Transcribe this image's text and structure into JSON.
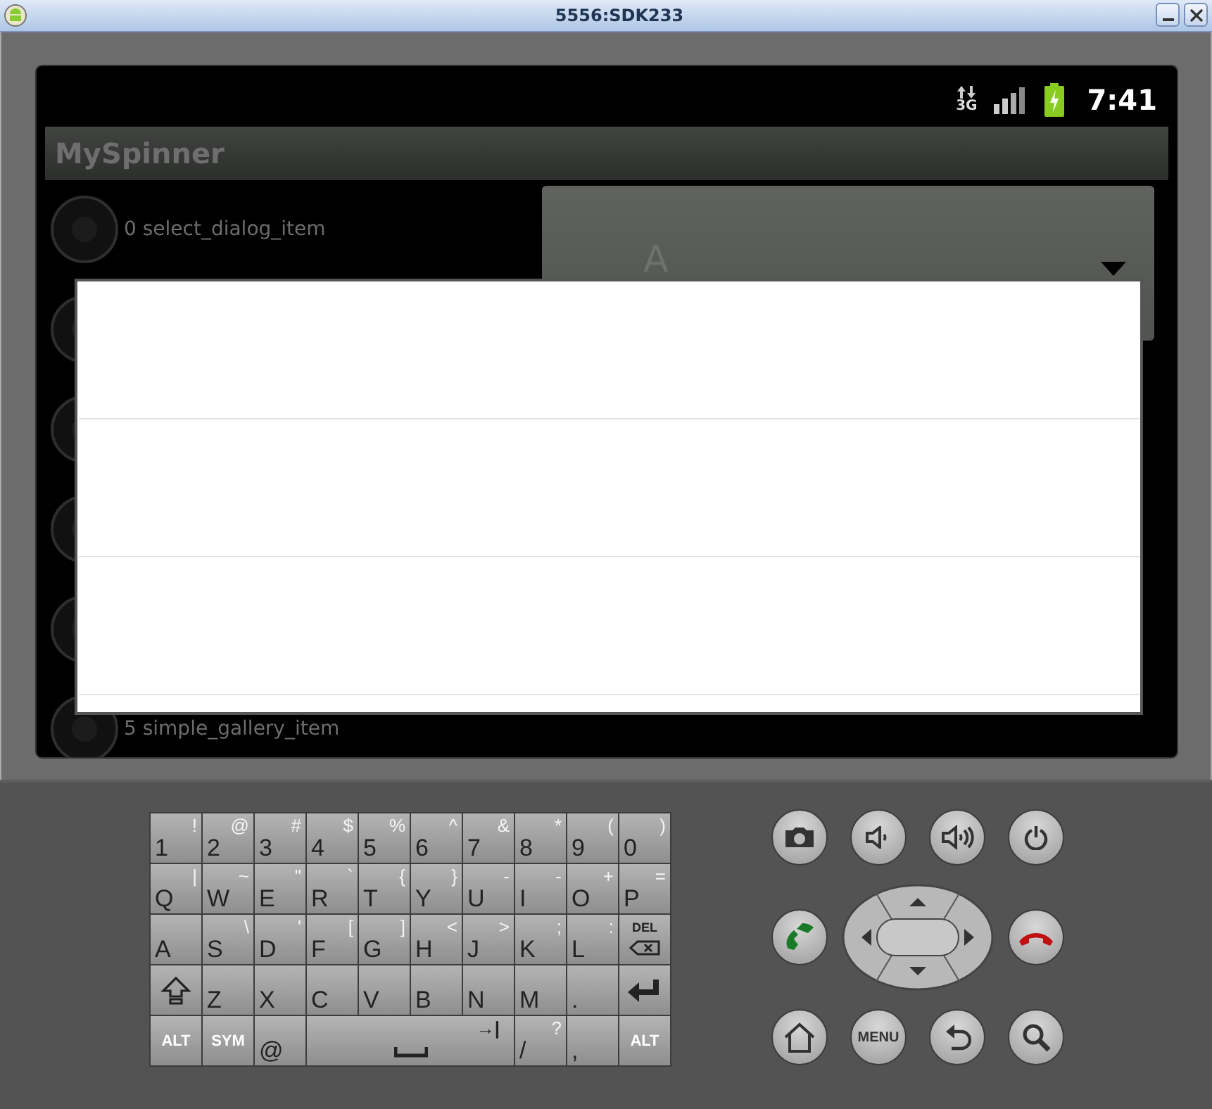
{
  "window": {
    "title": "5556:SDK233"
  },
  "status_bar": {
    "network": "3G",
    "time": "7:41"
  },
  "app_bar": {
    "title": "MySpinner"
  },
  "radio_items": [
    {
      "label": "0 select_dialog_item",
      "selected": false
    },
    {
      "selected": false
    },
    {
      "selected": false
    },
    {
      "selected": false
    },
    {
      "selected": false
    },
    {
      "label": "5 simple_gallery_item",
      "selected": false
    }
  ],
  "spinner": {
    "value": "A"
  },
  "keyboard": {
    "keys": [
      {
        "kind": "char",
        "main": "1",
        "alt": "!"
      },
      {
        "kind": "char",
        "main": "2",
        "alt": "@"
      },
      {
        "kind": "char",
        "main": "3",
        "alt": "#"
      },
      {
        "kind": "char",
        "main": "4",
        "alt": "$"
      },
      {
        "kind": "char",
        "main": "5",
        "alt": "%"
      },
      {
        "kind": "char",
        "main": "6",
        "alt": "^"
      },
      {
        "kind": "char",
        "main": "7",
        "alt": "&"
      },
      {
        "kind": "char",
        "main": "8",
        "alt": "*"
      },
      {
        "kind": "char",
        "main": "9",
        "alt": "("
      },
      {
        "kind": "char",
        "main": "0",
        "alt": ")"
      },
      {
        "kind": "char",
        "main": "Q",
        "alt": "|"
      },
      {
        "kind": "char",
        "main": "W",
        "alt": "~"
      },
      {
        "kind": "char",
        "main": "E",
        "alt": "\""
      },
      {
        "kind": "char",
        "main": "R",
        "alt": "`"
      },
      {
        "kind": "char",
        "main": "T",
        "alt": "{"
      },
      {
        "kind": "char",
        "main": "Y",
        "alt": "}"
      },
      {
        "kind": "char",
        "main": "U",
        "alt": "-"
      },
      {
        "kind": "char",
        "main": "I",
        "alt": "-"
      },
      {
        "kind": "char",
        "main": "O",
        "alt": "+"
      },
      {
        "kind": "char",
        "main": "P",
        "alt": "="
      },
      {
        "kind": "char",
        "main": "A"
      },
      {
        "kind": "char",
        "main": "S",
        "alt": "\\"
      },
      {
        "kind": "char",
        "main": "D",
        "alt": "'"
      },
      {
        "kind": "char",
        "main": "F",
        "alt": "["
      },
      {
        "kind": "char",
        "main": "G",
        "alt": "]"
      },
      {
        "kind": "char",
        "main": "H",
        "alt": "<"
      },
      {
        "kind": "char",
        "main": "J",
        "alt": ">"
      },
      {
        "kind": "char",
        "main": "K",
        "alt": ";"
      },
      {
        "kind": "char",
        "main": "L",
        "alt": ":"
      },
      {
        "kind": "del",
        "main": "DEL"
      },
      {
        "kind": "shift"
      },
      {
        "kind": "char",
        "main": "Z"
      },
      {
        "kind": "char",
        "main": "X"
      },
      {
        "kind": "char",
        "main": "C"
      },
      {
        "kind": "char",
        "main": "V"
      },
      {
        "kind": "char",
        "main": "B"
      },
      {
        "kind": "char",
        "main": "N"
      },
      {
        "kind": "char",
        "main": "M"
      },
      {
        "kind": "char",
        "main": "."
      },
      {
        "kind": "enter"
      },
      {
        "kind": "label",
        "main": "ALT"
      },
      {
        "kind": "label",
        "main": "SYM"
      },
      {
        "kind": "char",
        "main": "@"
      },
      {
        "kind": "space",
        "alt": "→|"
      },
      {
        "kind": "char",
        "main": "/",
        "alt": "?"
      },
      {
        "kind": "char",
        "main": ","
      },
      {
        "kind": "label",
        "main": "ALT"
      }
    ]
  },
  "menu_button": {
    "label": "MENU"
  }
}
